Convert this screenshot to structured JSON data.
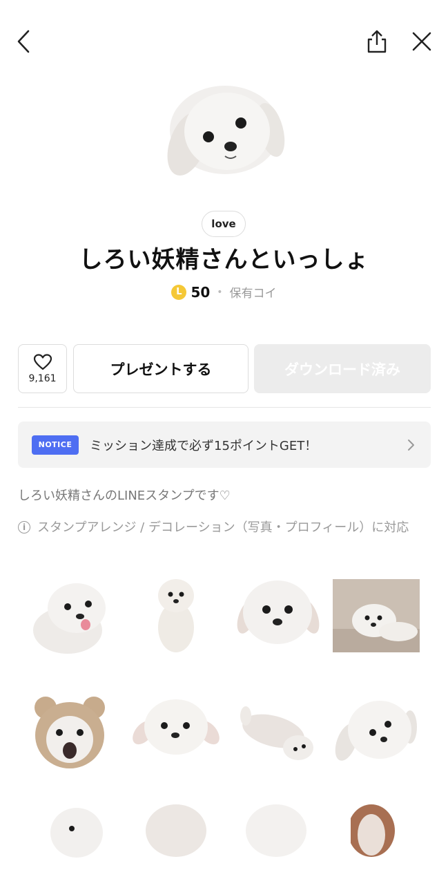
{
  "topbar": {
    "back_icon": "chevron-left-icon",
    "share_icon": "share-icon",
    "close_icon": "close-icon"
  },
  "product": {
    "tag": "love",
    "title": "しろい妖精さんといっしょ",
    "coin_letter": "L",
    "price": "50",
    "owned_label": "保有コイ"
  },
  "actions": {
    "like_count": "9,161",
    "present_label": "プレゼントする",
    "download_label": "ダウンロード済み"
  },
  "notice": {
    "badge": "NOTICE",
    "text": "ミッション達成で必ず15ポイントGET！"
  },
  "description": "しろい妖精さんのLINEスタンプです♡",
  "compat": {
    "icon_text": "i",
    "text": "スタンプアレンジ / デコレーション（写真・プロフィール）に対応"
  },
  "colors": {
    "notice_badge": "#4e6ef2",
    "coin": "#f5c836",
    "disabled_button": "#ececec"
  }
}
